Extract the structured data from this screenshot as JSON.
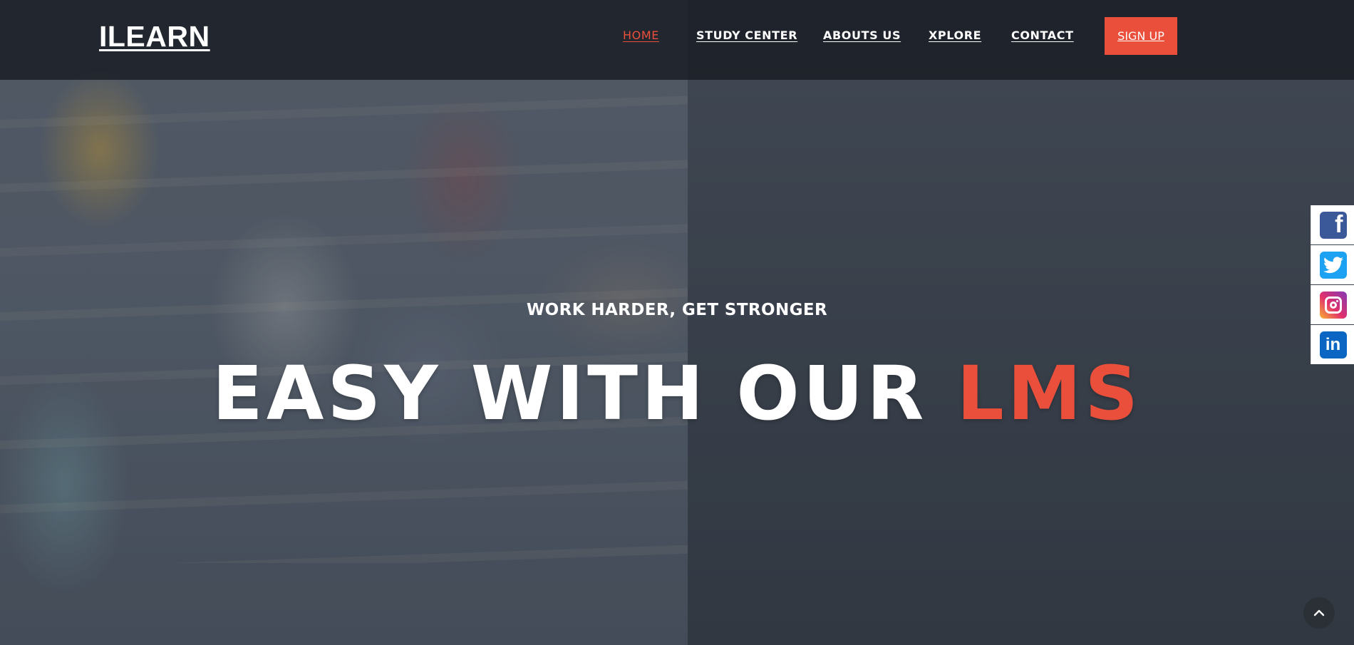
{
  "brand": {
    "logo": "ILEARN"
  },
  "nav": {
    "items": [
      {
        "label": "HOME",
        "active": true
      },
      {
        "label": "STUDY CENTER",
        "active": false
      },
      {
        "label": "ABOUTS US",
        "active": false
      },
      {
        "label": "XPLORE",
        "active": false
      },
      {
        "label": "CONTACT",
        "active": false
      }
    ],
    "signup_label": "SIGN UP"
  },
  "hero": {
    "tagline": "WORK HARDER, GET STRONGER",
    "headline": "EASY WITH OUR",
    "headline_accent": "LMS"
  },
  "social": {
    "items": [
      {
        "icon": "facebook-icon",
        "color": "#3b5998"
      },
      {
        "icon": "twitter-icon",
        "color": "#1da1f2"
      },
      {
        "icon": "instagram-icon",
        "color": "#e1306c"
      },
      {
        "icon": "linkedin-icon",
        "color": "#0a66c2"
      }
    ]
  },
  "scroll_top": {
    "icon": "chevron-up-icon"
  },
  "colors": {
    "accent": "#e94f3a",
    "navbar": "#191c23"
  }
}
